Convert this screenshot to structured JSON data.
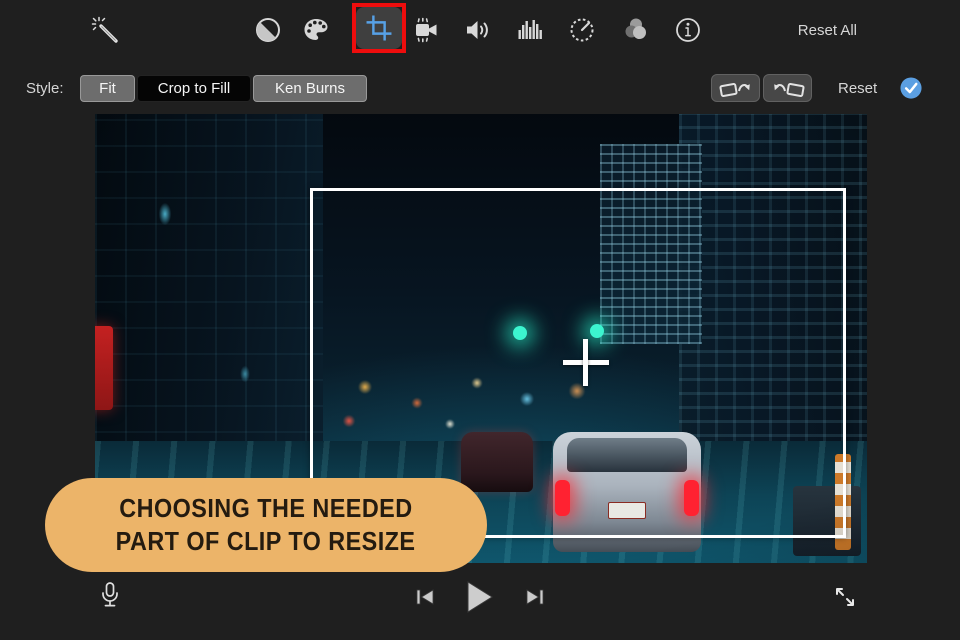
{
  "toolbar": {
    "reset_all_label": "Reset All",
    "active_tool": "crop",
    "icons": [
      "enhance-wand-icon",
      "color-balance-icon",
      "color-palette-icon",
      "crop-icon",
      "stabilization-icon",
      "volume-icon",
      "equalizer-icon",
      "speed-icon",
      "color-filters-icon",
      "info-icon"
    ]
  },
  "style_bar": {
    "label": "Style:",
    "options": [
      "Fit",
      "Crop to Fill",
      "Ken Burns"
    ],
    "selected_option": "Crop to Fill",
    "reset_label": "Reset",
    "rotate_icons": [
      "rotate-counterclockwise-icon",
      "rotate-clockwise-icon"
    ],
    "apply_icon": "blue-checkmark-icon"
  },
  "callout": {
    "line1": "CHOOSING THE NEEDED",
    "line2": "PART OF CLIP TO RESIZE"
  },
  "player": {
    "controls": [
      "skip-back-icon",
      "play-icon",
      "skip-forward-icon"
    ],
    "left_icon": "microphone-icon",
    "right_icon": "expand-fullscreen-icon"
  },
  "colors": {
    "background": "#1f1f1f",
    "accent_blue": "#5b9fe2",
    "crop_icon_blue": "#57a1e6",
    "annotation_red": "#ee0d0d",
    "callout_bg": "#ecb469",
    "callout_text": "#241b10",
    "selected_segment_bg": "#050505",
    "segment_bg": "#6d6d6d"
  }
}
